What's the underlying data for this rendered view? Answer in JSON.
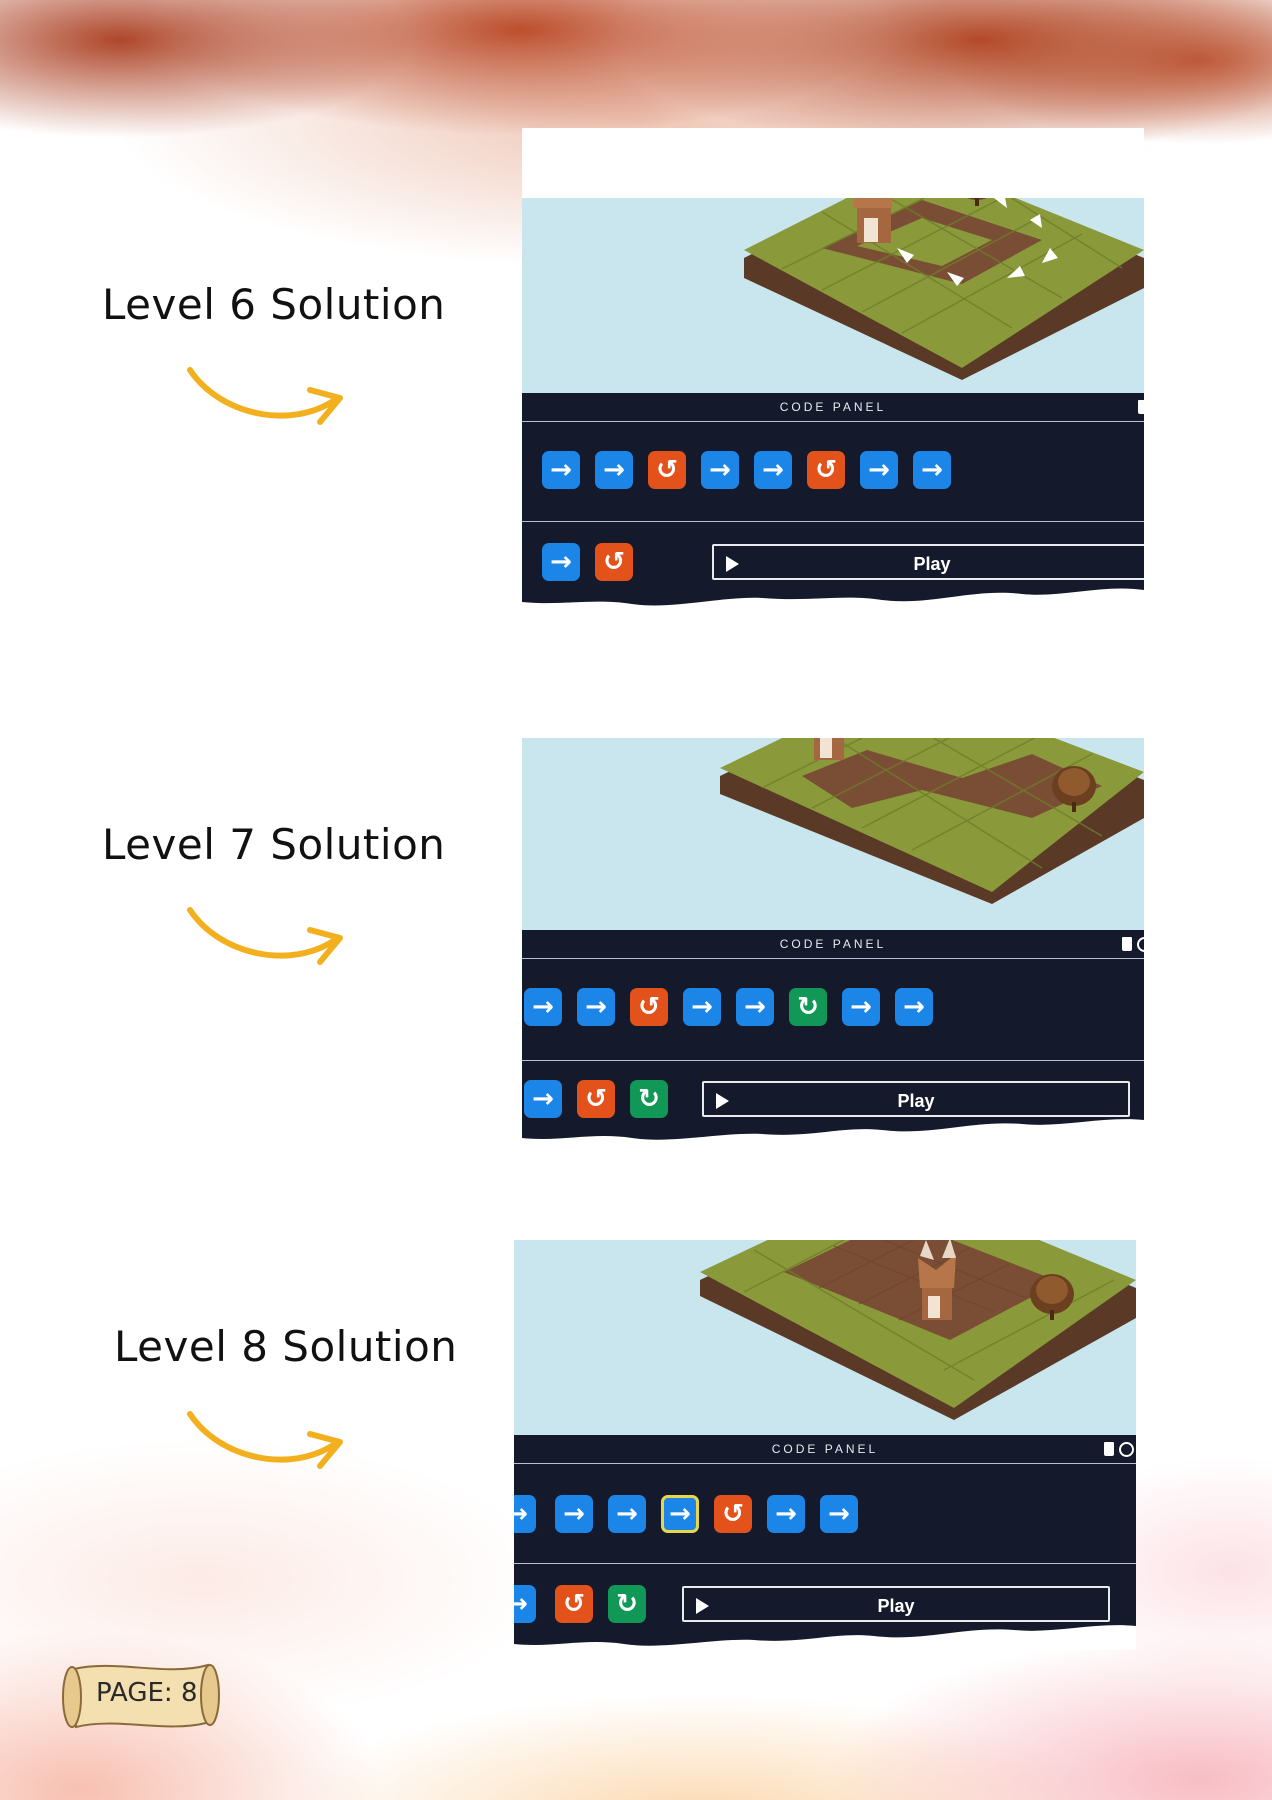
{
  "levels": [
    {
      "title": "Level 6 Solution",
      "panel_header": "CODE PANEL",
      "program": [
        "forward",
        "forward",
        "turn-left",
        "forward",
        "forward",
        "turn-left",
        "forward",
        "forward"
      ],
      "palette": [
        "forward",
        "turn-left"
      ],
      "play_label": "Play"
    },
    {
      "title": "Level 7 Solution",
      "panel_header": "CODE PANEL",
      "program": [
        "forward",
        "forward",
        "turn-left",
        "forward",
        "forward",
        "turn-right",
        "forward",
        "forward"
      ],
      "palette": [
        "forward",
        "turn-left",
        "turn-right"
      ],
      "play_label": "Play"
    },
    {
      "title": "Level 8 Solution",
      "panel_header": "CODE PANEL",
      "program": [
        "forward",
        "forward",
        "forward",
        "forward",
        "turn-left",
        "forward",
        "forward"
      ],
      "selected_index": 3,
      "palette": [
        "forward",
        "turn-left",
        "turn-right"
      ],
      "play_label": "Play"
    }
  ],
  "icons": {
    "forward": "→",
    "turn-left": "↺",
    "turn-right": "↻"
  },
  "colors": {
    "forward": "#1c86e8",
    "turn-left": "#e2521a",
    "turn-right": "#119857",
    "panel": "#141a2b",
    "sky": "#c9e6ee",
    "grass": "#8a9a3a",
    "path": "#7a4e34",
    "arrow_deco": "#f2b01e"
  },
  "page_label": "PAGE: 8"
}
